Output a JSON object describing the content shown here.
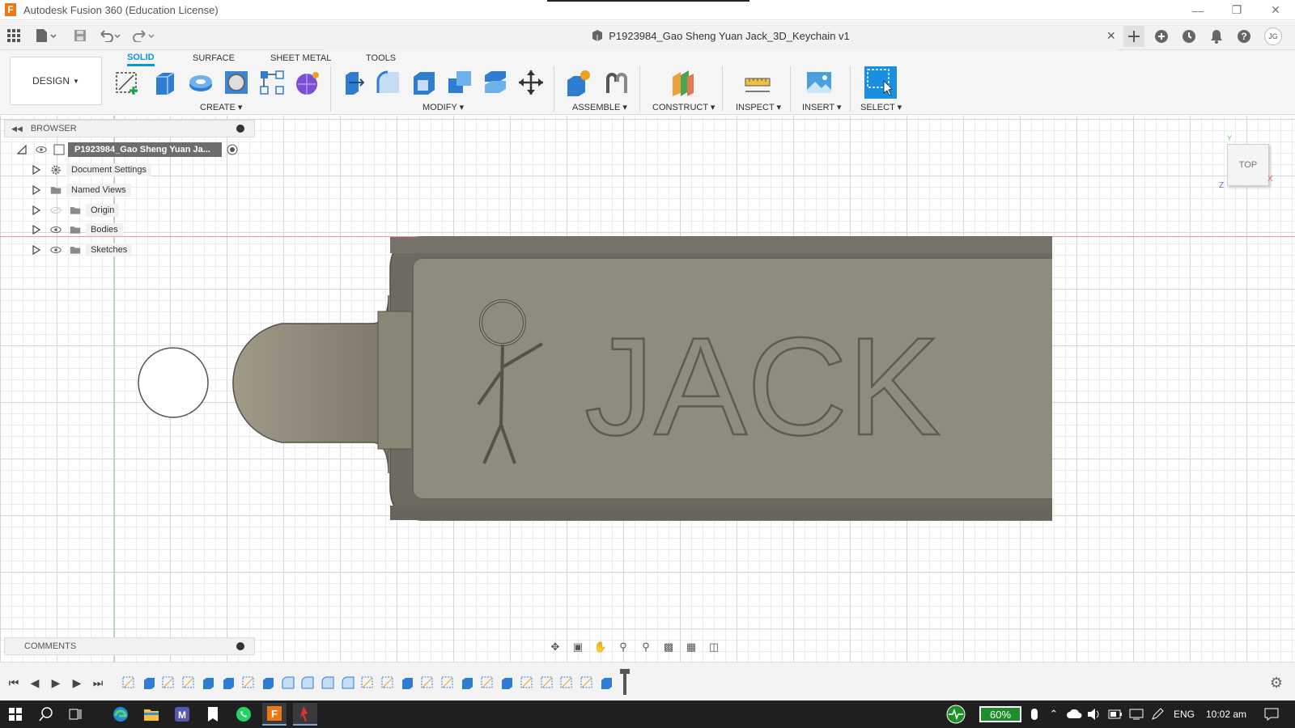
{
  "window": {
    "title": "Autodesk Fusion 360 (Education License)",
    "app_icon_letter": "F"
  },
  "document": {
    "tab_title": "P1923984_Gao Sheng Yuan Jack_3D_Keychain v1",
    "close_glyph": "×"
  },
  "user": {
    "initials": "JG"
  },
  "ribbon": {
    "workspace_label": "DESIGN",
    "tabs": [
      {
        "label": "SOLID",
        "active": true
      },
      {
        "label": "SURFACE",
        "active": false
      },
      {
        "label": "SHEET METAL",
        "active": false
      },
      {
        "label": "TOOLS",
        "active": false
      }
    ],
    "groups": {
      "create": "CREATE",
      "modify": "MODIFY",
      "assemble": "ASSEMBLE",
      "construct": "CONSTRUCT",
      "inspect": "INSPECT",
      "insert": "INSERT",
      "select": "SELECT"
    }
  },
  "browser": {
    "header": "BROWSER",
    "root": "P1923984_Gao Sheng Yuan Ja...",
    "items": [
      {
        "label": "Document Settings",
        "icon": "gear-icon"
      },
      {
        "label": "Named Views",
        "icon": "folder-icon"
      },
      {
        "label": "Origin",
        "icon": "folder-icon"
      },
      {
        "label": "Bodies",
        "icon": "folder-icon"
      },
      {
        "label": "Sketches",
        "icon": "folder-icon"
      }
    ]
  },
  "comments": {
    "header": "COMMENTS"
  },
  "viewport": {
    "model_text": "JACK",
    "view_cube_label": "TOP",
    "axis_labels": {
      "x": "X",
      "y": "Y",
      "z": "Z"
    }
  },
  "taskbar": {
    "battery": "60%",
    "language": "ENG",
    "time": "10:02 am"
  },
  "colors": {
    "accent": "#0696d7",
    "model_face": "#8f8c7f",
    "model_edge": "#5f5c55",
    "taskbar": "#1f1f1f"
  }
}
